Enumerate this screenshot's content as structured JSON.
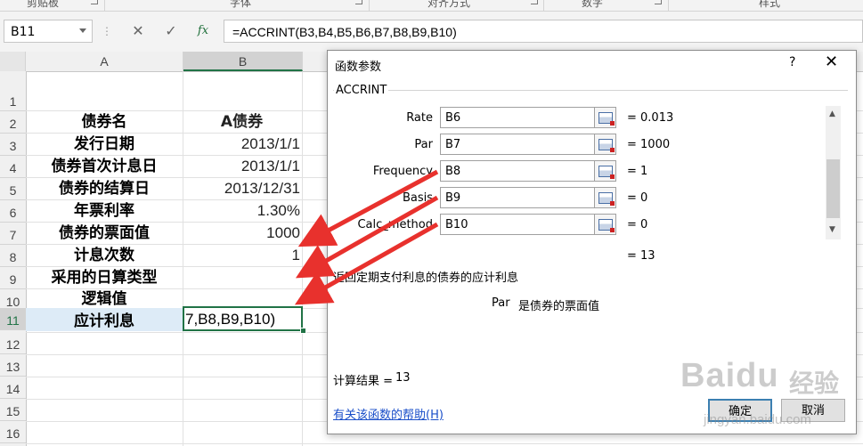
{
  "ribbon_groups": [
    "剪贴板",
    "字体",
    "对齐方式",
    "数字",
    "样式"
  ],
  "name_box": "B11",
  "formula_buttons": {
    "cancel": "✕",
    "enter": "✓",
    "insert_function": "fx"
  },
  "formula": "=ACCRINT(B3,B4,B5,B6,B7,B8,B9,B10)",
  "columns": [
    "A",
    "B"
  ],
  "rows": [
    "1",
    "2",
    "3",
    "4",
    "5",
    "6",
    "7",
    "8",
    "9",
    "10",
    "11",
    "12",
    "13",
    "14",
    "15",
    "16"
  ],
  "sheet": {
    "A": [
      "",
      "债券名",
      "发行日期",
      "债券首次计息日",
      "债券的结算日",
      "年票利率",
      "债券的票面值",
      "计息次数",
      "采用的日算类型",
      "逻辑值",
      "应计利息"
    ],
    "B": [
      "",
      "A债券",
      "2013/1/1",
      "2013/1/1",
      "2013/12/31",
      "1.30%",
      "1000",
      "1",
      "",
      "",
      "7,B8,B9,B10)"
    ]
  },
  "dialog": {
    "title": "函数参数",
    "help_glyph": "?",
    "close_glyph": "✕",
    "function_name": "ACCRINT",
    "args": [
      {
        "label": "Rate",
        "input": "B6",
        "value": "= 0.013"
      },
      {
        "label": "Par",
        "input": "B7",
        "value": "= 1000"
      },
      {
        "label": "Frequency",
        "input": "B8",
        "value": "= 1"
      },
      {
        "label": "Basis",
        "input": "B9",
        "value": "= 0"
      },
      {
        "label": "Calc_method",
        "input": "B10",
        "value": "= 0"
      }
    ],
    "result_inline": "= 13",
    "description": "返回定期支付利息的债券的应计利息",
    "param_name": "Par",
    "param_desc": "是债券的票面值",
    "calc_result_label": "计算结果 =",
    "calc_result_value": "13",
    "help_link": "有关该函数的帮助(H)",
    "ok": "确定",
    "cancel": "取消"
  },
  "watermark": {
    "brand": "Baidu",
    "sub": "经验",
    "url": "jingyan.baidu.com"
  },
  "colors": {
    "arrow": "#e8312d",
    "link": "#1a4fc9",
    "selection": "#217346"
  }
}
